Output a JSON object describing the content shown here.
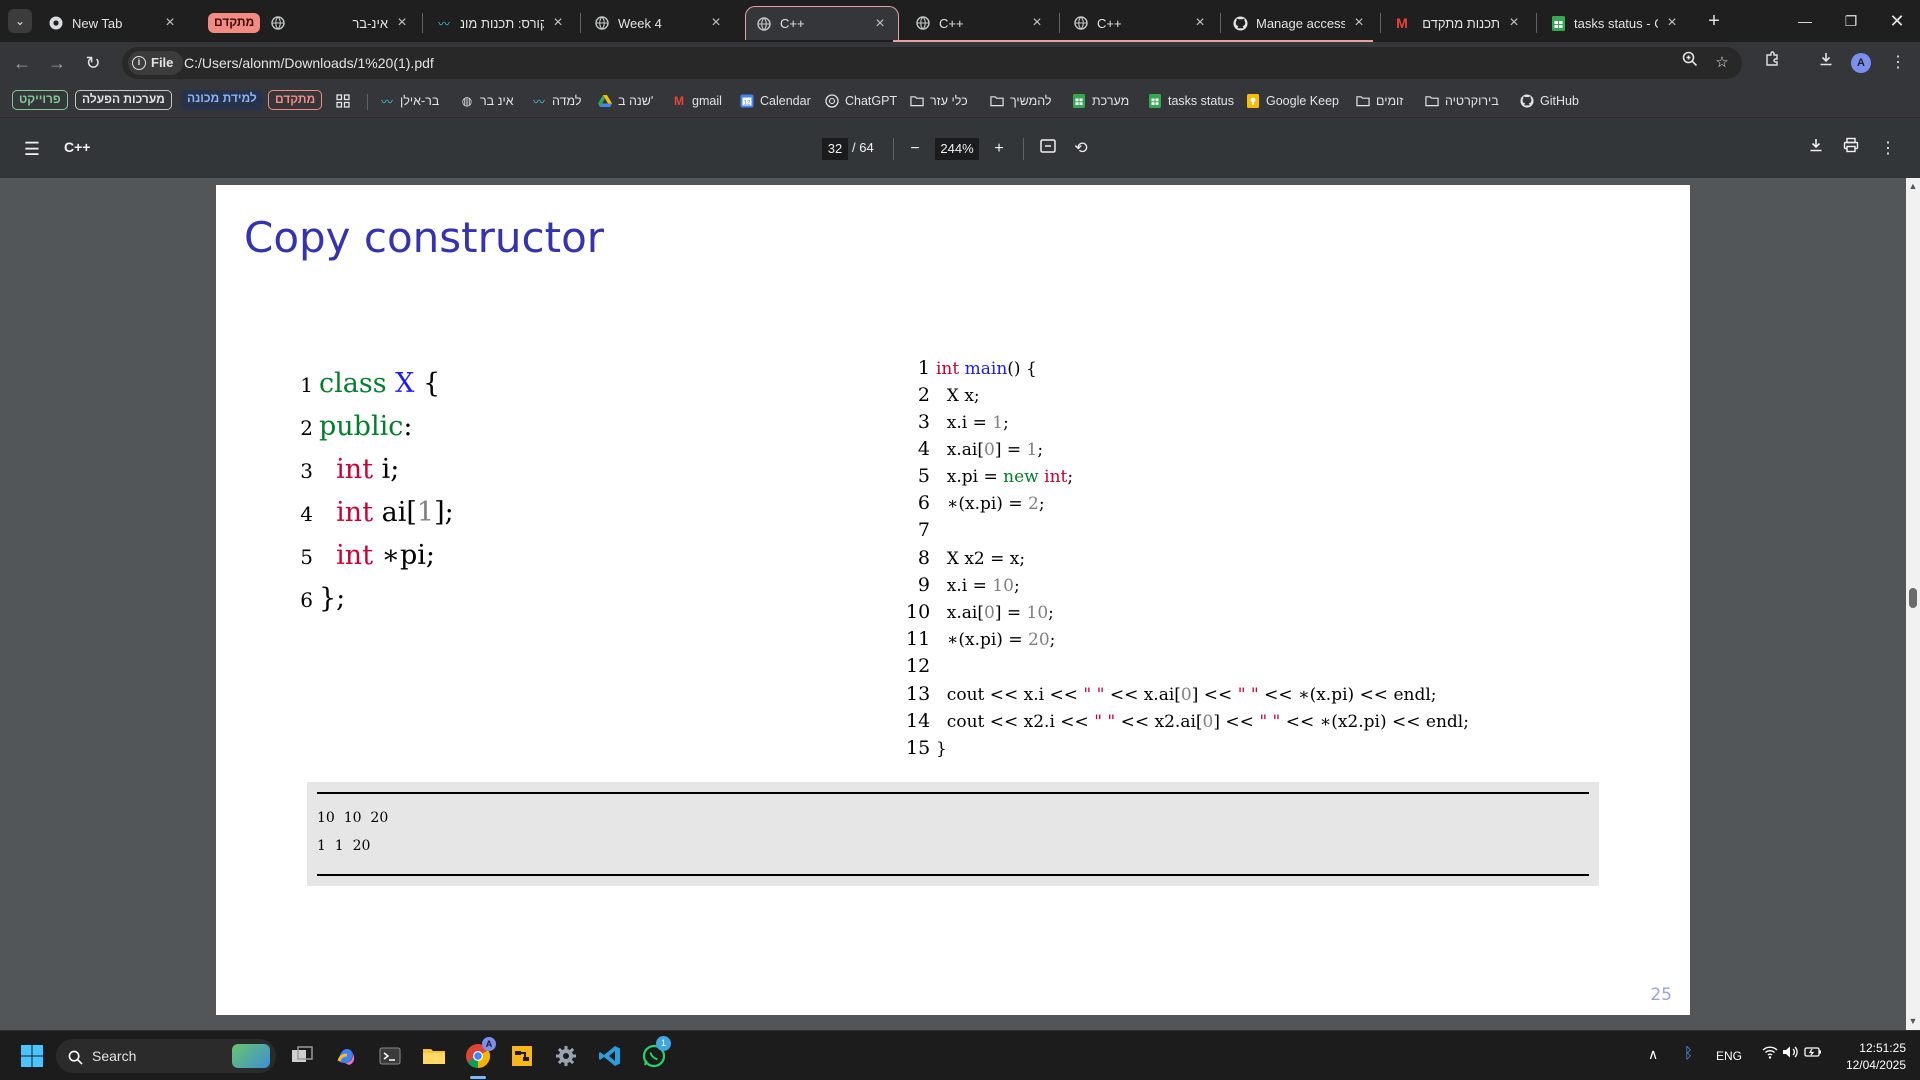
{
  "tabs": [
    {
      "title": "New Tab",
      "icon": "chrome-icon"
    },
    {
      "title": "מתקדם",
      "icon": "badge"
    },
    {
      "title": "אינ-בר",
      "icon": "globe-icon"
    },
    {
      "title": "קורס: תכנות מונ",
      "icon": "wave-icon"
    },
    {
      "title": "Week 4",
      "icon": "globe-icon"
    },
    {
      "title": "C++",
      "icon": "globe-icon"
    },
    {
      "title": "C++",
      "icon": "globe-icon"
    },
    {
      "title": "C++",
      "icon": "globe-icon"
    },
    {
      "title": "Manage access",
      "icon": "github-icon"
    },
    {
      "title": "תכנות מתקדם",
      "icon": "gmail-icon"
    },
    {
      "title": "tasks status - Go",
      "icon": "sheets-icon"
    }
  ],
  "toolbar": {
    "file_chip": "File",
    "url": "C:/Users/alonm/Downloads/1%20(1).pdf",
    "avatar_letter": "A"
  },
  "bookmarks": {
    "pills": [
      "פרוייקט",
      "מערכות הפעלה",
      "למידת מכונה",
      "מתקדם"
    ],
    "items": [
      "בר-אילן",
      "אינ בר",
      "למדה",
      "שנה ב'",
      "gmail",
      "Calendar",
      "ChatGPT",
      "כלי עזר",
      "להמשיך",
      "מערכת",
      "tasks status",
      "Google Keep",
      "זומים",
      "בירוקרטיה",
      "GitHub"
    ]
  },
  "pdf": {
    "title": "C++",
    "current_page": "32",
    "total_pages": "/ 64",
    "zoom": "244%"
  },
  "slide": {
    "title": "Copy constructor",
    "page_number": "25",
    "left_line_numbers": [
      "1",
      "2",
      "3",
      "4",
      "5",
      "6"
    ],
    "right_line_numbers": [
      "1",
      "2",
      "3",
      "4",
      "5",
      "6",
      "7",
      "8",
      "9",
      "10",
      "11",
      "12",
      "13",
      "14",
      "15"
    ],
    "output": [
      "10  10  20",
      "1  1  20"
    ]
  },
  "taskbar": {
    "search_label": "Search",
    "lang": "ENG",
    "time": "12:51:25",
    "date": "12/04/2025",
    "whatsapp_badge": "1",
    "chrome_badge": "A"
  },
  "colors": {
    "slide_title": "#3333b3",
    "keyword": "#00802b",
    "type": "#cc0033",
    "class_name": "#1a1aff",
    "number": "#808080",
    "active_tab_outline": "#e8a0a0"
  }
}
